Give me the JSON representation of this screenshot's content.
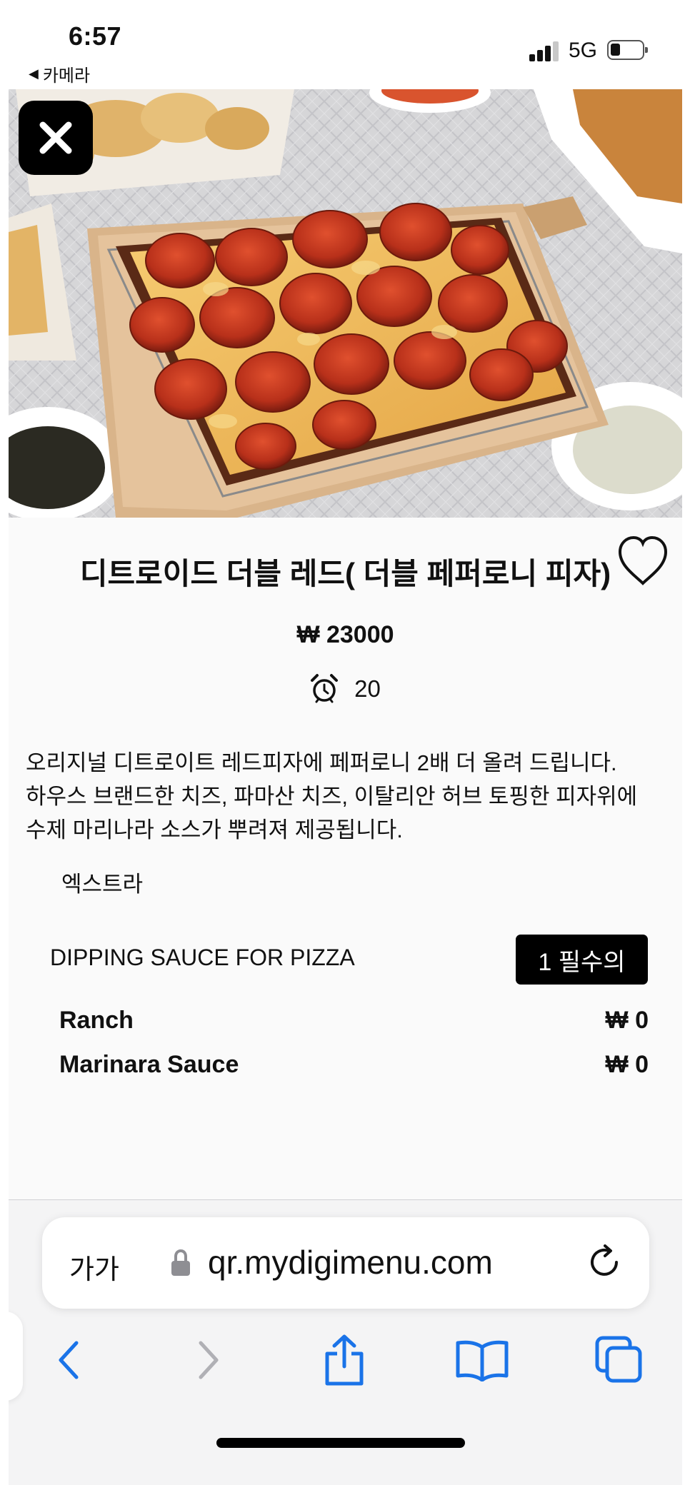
{
  "status_bar": {
    "time": "6:57",
    "back_app": "카메라",
    "network": "5G",
    "battery_level": 0.3
  },
  "product": {
    "title": "디트로이드 더블 레드( 더블 페퍼로니 피자)",
    "price": "₩ 23000",
    "prep_time": "20",
    "description": [
      "오리지널 디트로이트 레드피자에 페퍼로니 2배 더 올려 드립니다.",
      "하우스 브랜드한 치즈, 파마산 치즈, 이탈리안 허브 토핑한 피자위에",
      "수제 마리나라 소스가 뿌려져 제공됩니다."
    ],
    "extras_label": "엑스트라"
  },
  "option_group": {
    "title": "DIPPING SAUCE FOR PIZZA",
    "required_badge": "1 필수의",
    "options": [
      {
        "name": "Ranch",
        "price": "₩ 0"
      },
      {
        "name": "Marinara Sauce",
        "price": "₩ 0"
      }
    ]
  },
  "browser": {
    "text_size_button": "가가",
    "url": "qr.mydigimenu.com"
  },
  "icons": {
    "close": "close-icon",
    "favorite": "heart-icon",
    "prep_time": "alarm-clock-icon",
    "lock": "lock-icon",
    "reload": "reload-icon",
    "back": "chevron-left-icon",
    "forward": "chevron-right-icon",
    "share": "share-icon",
    "bookmarks": "book-icon",
    "tabs": "tabs-icon"
  },
  "colors": {
    "accent": "#1a73e8",
    "badge_bg": "#000000",
    "disabled": "#b0b0b5"
  }
}
